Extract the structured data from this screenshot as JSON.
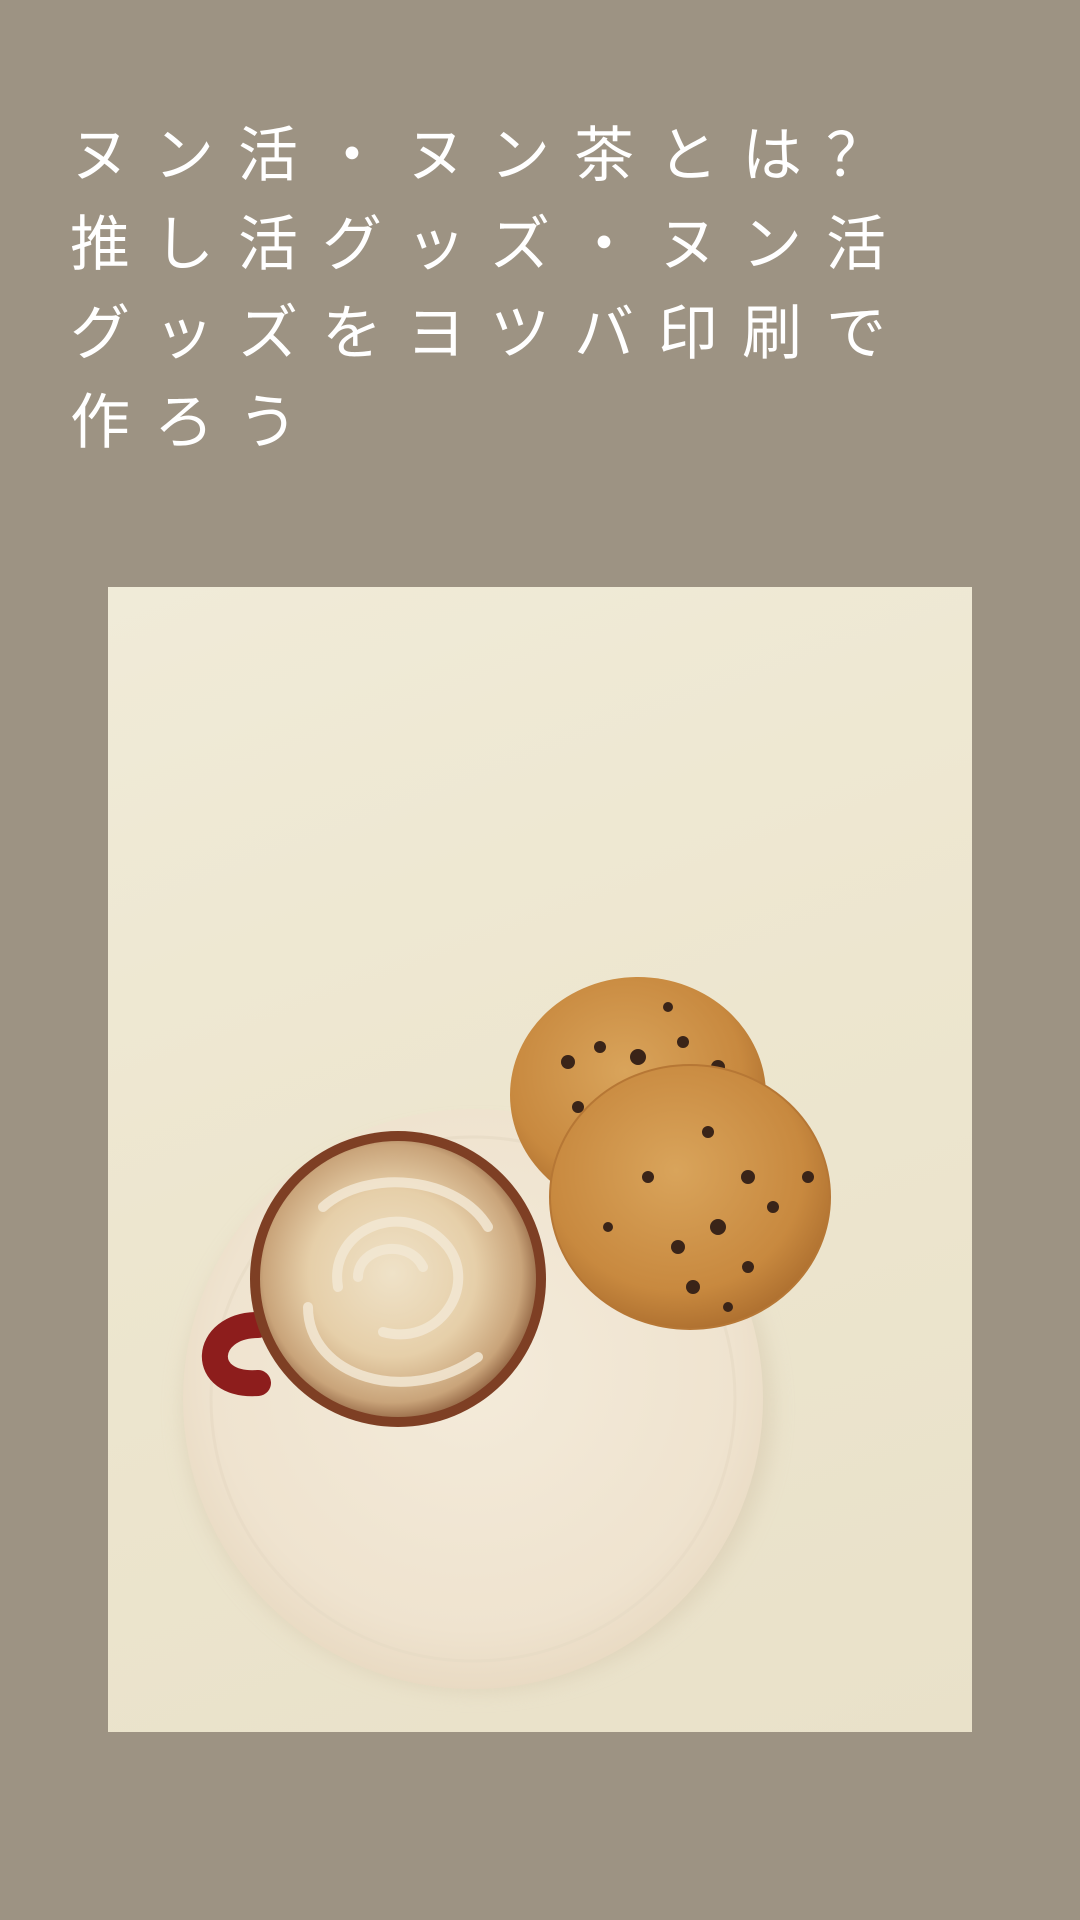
{
  "post": {
    "title": "ヌン活・ヌン茶とは？推し活グッズ・ヌン活グッズをヨツバ印刷で作ろう"
  },
  "colors": {
    "background": "#9d9383",
    "title_text": "#ffffff",
    "photo_table": "#ede6cf",
    "plate": "#f1e6d3",
    "cup": "#8d1d1c",
    "latte_foam": "#e9d6b6",
    "cookie": "#c98c45"
  },
  "photo": {
    "subject": "latte-and-cookies-on-plate"
  }
}
